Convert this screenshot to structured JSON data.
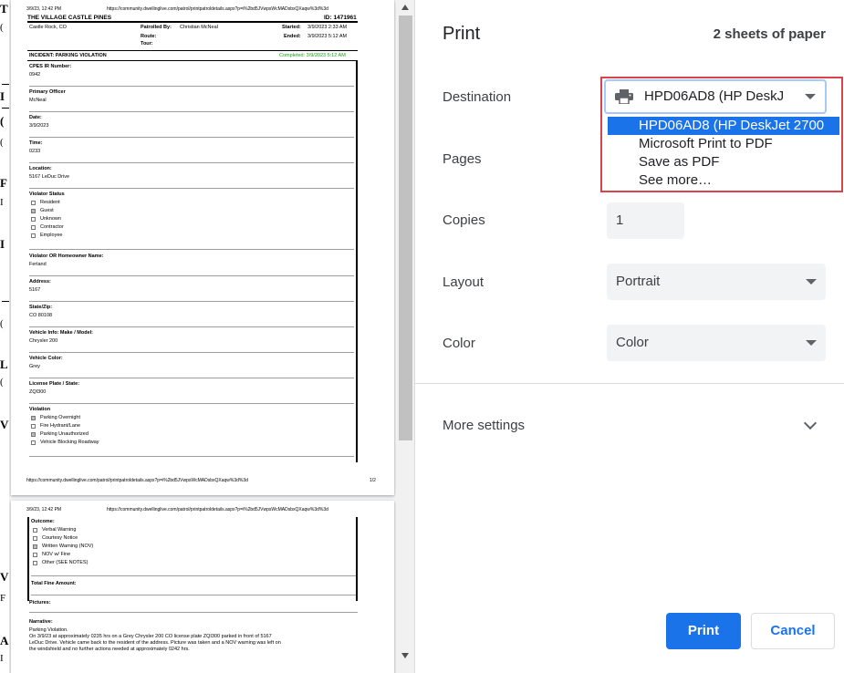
{
  "background_page": {
    "letters": [
      "T",
      "(",
      "I",
      "(",
      "(",
      "F",
      "I",
      "I",
      "",
      "L",
      "(",
      "L",
      "(",
      "I",
      "V",
      "V",
      "F",
      "A",
      "I"
    ]
  },
  "preview": {
    "sheet1": {
      "header_date": "3/9/23, 12:42 PM",
      "header_url": "https://community.dwellinglive.com/patrol/printpatroldetails.aspx?p=i%2bd5JVwpsWcMADsbxQXaqw%3d%3d",
      "org_name": "THE VILLAGE CASTLE PINES",
      "report_id": "ID: 1471961",
      "location": "Castle Rock, CO",
      "patrolled_by_label": "Patrolled By:",
      "patrolled_by": "Christian McNeal",
      "route_label": "Route:",
      "tour_label": "Tour:",
      "started_label": "Started:",
      "started": "3/9/2023 2:33 AM",
      "ended_label": "Ended:",
      "ended": "3/9/2023 5:12 AM",
      "incident": "INCIDENT: PARKING VIOLATION",
      "completed": "Completed: 3/9/2023 5:12 AM",
      "fields": [
        {
          "label": "CPES IR Number:",
          "value": "0942"
        },
        {
          "label": "Primary Officer",
          "value": "McNeal"
        },
        {
          "label": "Date:",
          "value": "3/9/2023"
        },
        {
          "label": "Time:",
          "value": "0233"
        },
        {
          "label": "Location:",
          "value": "5167 LeDuc Drive"
        }
      ],
      "violator_status_label": "Violator Status",
      "violator_status_options": [
        "Resident",
        "Guest",
        "Unknown",
        "Contractor",
        "Employee"
      ],
      "fields2": [
        {
          "label": "Violator OR Homeowner Name:",
          "value": "Ferland"
        },
        {
          "label": "Address:",
          "value": "5167"
        },
        {
          "label": "State/Zip:",
          "value": "CO 80108"
        },
        {
          "label": "Vehicle Info: Make / Model:",
          "value": "Chrysler 200"
        },
        {
          "label": "Vehicle Color:",
          "value": "Grey"
        },
        {
          "label": "License Plate / State:",
          "value": "ZQI300"
        }
      ],
      "violation_label": "Violation",
      "violation_options": [
        "Parking Overnight",
        "Fire Hydrant/Lane",
        "Parking Unauthorized",
        "Vehicle Blocking Roadway"
      ],
      "footer_url": "https://community.dwellinglive.com/patrol/printpatroldetails.aspx?p=i%2bd5JVwpsWcMADsbxQXaqw%3d%3d",
      "footer_page": "1/2"
    },
    "sheet2": {
      "header_date": "3/9/23, 12:42 PM",
      "header_url": "https://community.dwellinglive.com/patrol/printpatroldetails.aspx?p=i%2bd5JVwpsWcMADsbxQXaqw%3d%3d",
      "outcome_label": "Outcome:",
      "outcome_options": [
        "Verbal Warning",
        "Courtesy Notice",
        "Written Warning (NOV)",
        "NOV w/ Fine",
        "Other (SEE NOTES)"
      ],
      "total_fine_label": "Total Fine Amount:",
      "pictures_label": "Pictures:",
      "narrative_label": "Narrative:",
      "narrative_lines": [
        "Parking Violation.",
        "On 3/9/23 at approximately 0235 hrs on a Grey Chrysler 200 CO license plate ZQI300 parked in front of 5167",
        "LeDuc Drive. Vehicle came back to the resident of the address. Picture was taken and a NOV warning was left on",
        "the windshield and no further actions needed at approximately 0242 hrs."
      ]
    }
  },
  "print_panel": {
    "title": "Print",
    "sheets": "2 sheets of paper",
    "destination_label": "Destination",
    "destination_value": "HPD06AD8 (HP DeskJ",
    "destination_options": [
      "HPD06AD8 (HP DeskJet 2700",
      "Microsoft Print to PDF",
      "Save as PDF",
      "See more…"
    ],
    "pages_label": "Pages",
    "copies_label": "Copies",
    "copies_value": "1",
    "layout_label": "Layout",
    "layout_value": "Portrait",
    "color_label": "Color",
    "color_value": "Color",
    "more_settings_label": "More settings",
    "print_button": "Print",
    "cancel_button": "Cancel",
    "accent_color": "#1a73e8",
    "highlight_border_color": "#d9434c"
  }
}
